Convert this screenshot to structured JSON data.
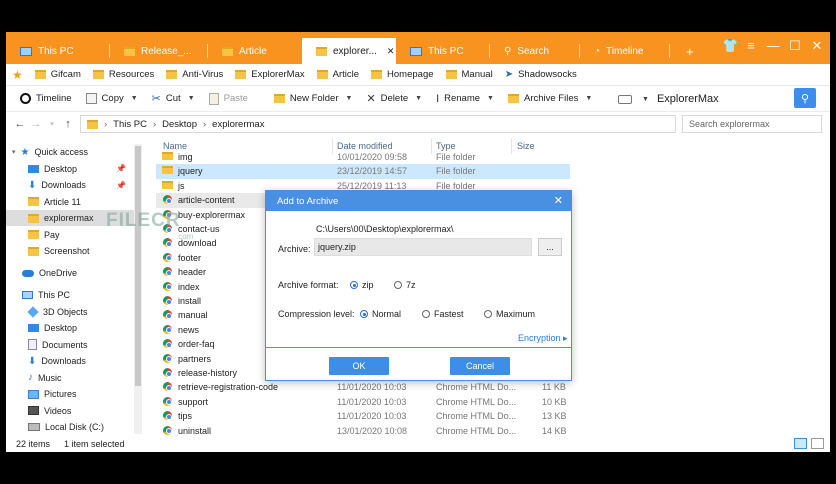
{
  "tabs": [
    {
      "label": "This PC",
      "icon": "monitor-icon"
    },
    {
      "label": "Release_...",
      "icon": "folder-icon"
    },
    {
      "label": "Article",
      "icon": "folder-icon"
    },
    {
      "label": "explorer...",
      "icon": "folder-icon",
      "active": true
    },
    {
      "label": "This PC",
      "icon": "monitor-icon"
    },
    {
      "label": "Search",
      "icon": "search-icon"
    },
    {
      "label": "Timeline",
      "icon": "timeline-icon"
    }
  ],
  "new_tab": "+",
  "favorites": [
    "Gifcam",
    "Resources",
    "Anti-Virus",
    "ExplorerMax",
    "Article",
    "Homepage",
    "Manual",
    "Shadowsocks"
  ],
  "toolbar": {
    "timeline": "Timeline",
    "copy": "Copy",
    "cut": "Cut",
    "paste": "Paste",
    "new_folder": "New Folder",
    "delete": "Delete",
    "rename": "Rename",
    "archive": "Archive Files",
    "location": "ExplorerMax"
  },
  "address": {
    "crumbs": [
      "This PC",
      "Desktop",
      "explorermax"
    ],
    "search_placeholder": "Search explorermax"
  },
  "sidebar": [
    {
      "label": "Quick access",
      "icon": "star-icon"
    },
    {
      "label": "Desktop",
      "icon": "desktop-icon",
      "pinned": true
    },
    {
      "label": "Downloads",
      "icon": "download-icon",
      "pinned": true
    },
    {
      "label": "Article 11",
      "icon": "folder-icon"
    },
    {
      "label": "explorermax",
      "icon": "folder-icon",
      "selected": true
    },
    {
      "label": "Pay",
      "icon": "folder-icon"
    },
    {
      "label": "Screenshot",
      "icon": "folder-icon"
    },
    {
      "label": "OneDrive",
      "icon": "cloud-icon"
    },
    {
      "label": "This PC",
      "icon": "pc-icon"
    },
    {
      "label": "3D Objects",
      "icon": "cube-icon"
    },
    {
      "label": "Desktop",
      "icon": "desktop-icon"
    },
    {
      "label": "Documents",
      "icon": "document-icon"
    },
    {
      "label": "Downloads",
      "icon": "download-icon"
    },
    {
      "label": "Music",
      "icon": "music-icon"
    },
    {
      "label": "Pictures",
      "icon": "picture-icon"
    },
    {
      "label": "Videos",
      "icon": "video-icon"
    },
    {
      "label": "Local Disk (C:)",
      "icon": "disk-icon"
    }
  ],
  "columns": {
    "name": "Name",
    "date": "Date modified",
    "type": "Type",
    "size": "Size"
  },
  "files": [
    {
      "name": "img",
      "date": "10/01/2020 09:58",
      "type": "File folder",
      "size": "",
      "kind": "folder"
    },
    {
      "name": "jquery",
      "date": "23/12/2019 14:57",
      "type": "File folder",
      "size": "",
      "kind": "folder"
    },
    {
      "name": "js",
      "date": "25/12/2019 11:13",
      "type": "File folder",
      "size": "",
      "kind": "folder"
    },
    {
      "name": "article-content",
      "date": "",
      "type": "",
      "size": "",
      "kind": "html"
    },
    {
      "name": "buy-explorermax",
      "date": "",
      "type": "",
      "size": "",
      "kind": "html"
    },
    {
      "name": "contact-us",
      "date": "",
      "type": "",
      "size": "",
      "kind": "html"
    },
    {
      "name": "download",
      "date": "",
      "type": "",
      "size": "",
      "kind": "html"
    },
    {
      "name": "footer",
      "date": "",
      "type": "",
      "size": "",
      "kind": "html"
    },
    {
      "name": "header",
      "date": "",
      "type": "",
      "size": "",
      "kind": "html"
    },
    {
      "name": "index",
      "date": "",
      "type": "",
      "size": "",
      "kind": "html"
    },
    {
      "name": "install",
      "date": "",
      "type": "",
      "size": "",
      "kind": "html"
    },
    {
      "name": "manual",
      "date": "",
      "type": "",
      "size": "",
      "kind": "html"
    },
    {
      "name": "news",
      "date": "",
      "type": "",
      "size": "",
      "kind": "html"
    },
    {
      "name": "order-faq",
      "date": "",
      "type": "",
      "size": "",
      "kind": "html"
    },
    {
      "name": "partners",
      "date": "",
      "type": "",
      "size": "",
      "kind": "html"
    },
    {
      "name": "release-history",
      "date": "",
      "type": "",
      "size": "",
      "kind": "html"
    },
    {
      "name": "retrieve-registration-code",
      "date": "11/01/2020 10:03",
      "type": "Chrome HTML Do...",
      "size": "11 KB",
      "kind": "html"
    },
    {
      "name": "support",
      "date": "11/01/2020 10:03",
      "type": "Chrome HTML Do...",
      "size": "10 KB",
      "kind": "html"
    },
    {
      "name": "tips",
      "date": "11/01/2020 10:03",
      "type": "Chrome HTML Do...",
      "size": "13 KB",
      "kind": "html"
    },
    {
      "name": "uninstall",
      "date": "13/01/2020 10:08",
      "type": "Chrome HTML Do...",
      "size": "14 KB",
      "kind": "html"
    }
  ],
  "status": {
    "count": "22 items",
    "selected": "1 item selected"
  },
  "watermark": {
    "main": "FILECR",
    "sub": ".com"
  },
  "dialog": {
    "title": "Add to Archive",
    "close": "✕",
    "path": "C:\\Users\\00\\Desktop\\explorermax\\",
    "archive_label": "Archive:",
    "archive_value": "jquery.zip",
    "browse": "...",
    "format_label": "Archive format:",
    "formats": [
      {
        "label": "zip",
        "checked": true
      },
      {
        "label": "7z",
        "checked": false
      }
    ],
    "compression_label": "Compression level:",
    "levels": [
      {
        "label": "Normal",
        "checked": true
      },
      {
        "label": "Fastest",
        "checked": false
      },
      {
        "label": "Maximum",
        "checked": false
      }
    ],
    "encryption": "Encryption ▸",
    "ok": "OK",
    "cancel": "Cancel"
  }
}
